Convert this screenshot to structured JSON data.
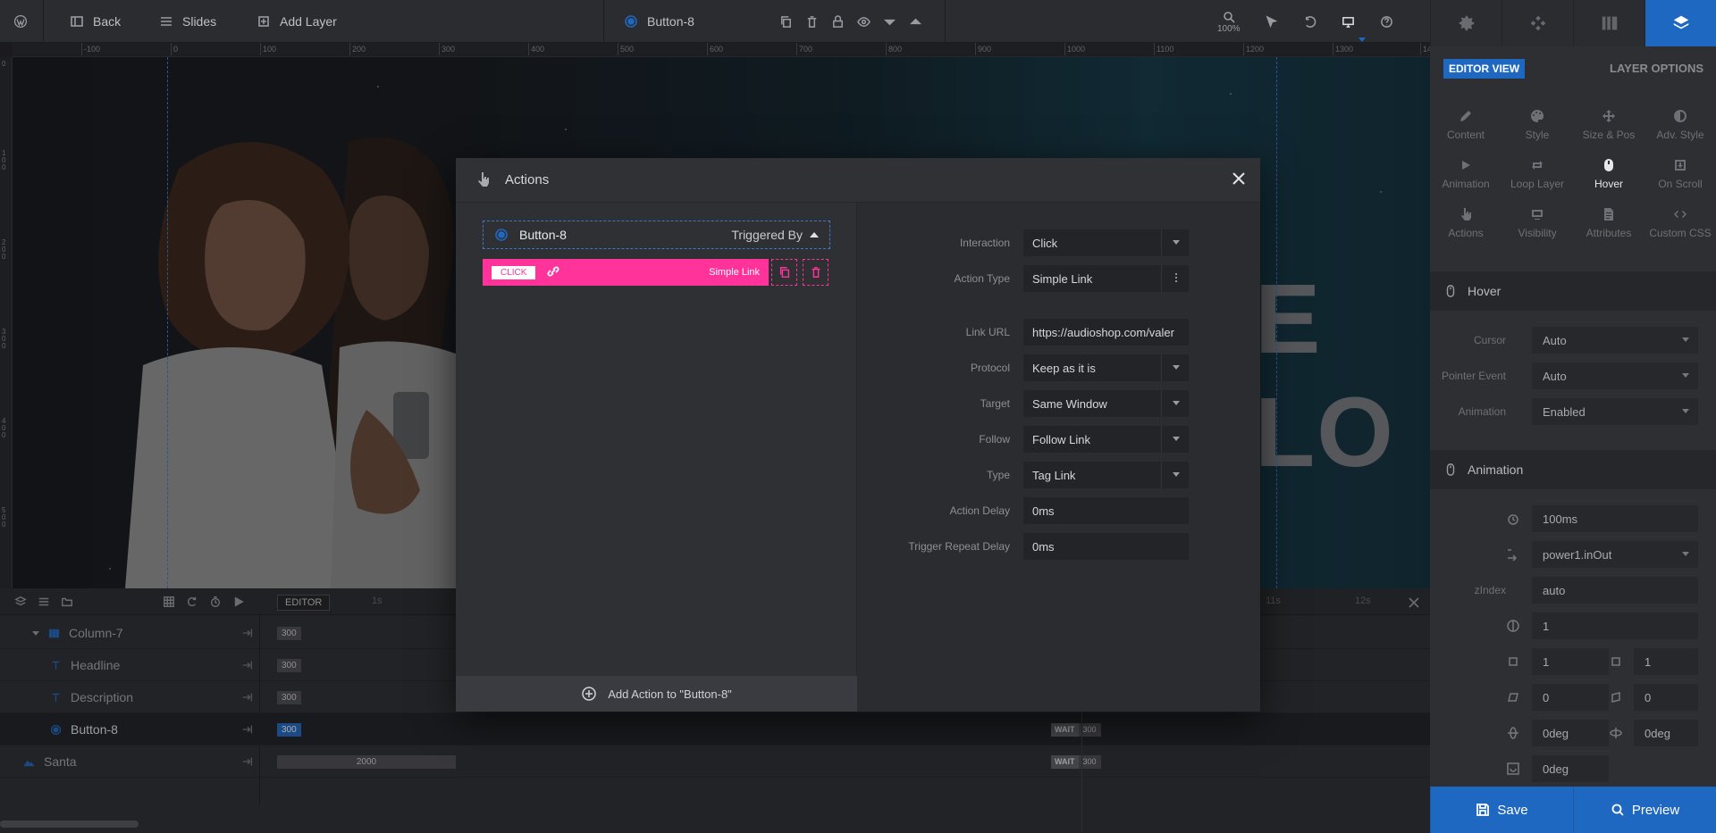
{
  "topbar": {
    "back_label": "Back",
    "slides_label": "Slides",
    "add_layer_label": "Add Layer",
    "layer_name": "Button-8",
    "zoom": "100%"
  },
  "ruler": {
    "top": [
      "-100",
      "0",
      "100",
      "200",
      "300",
      "400",
      "500",
      "600",
      "700",
      "800",
      "900",
      "1000",
      "1100",
      "1200",
      "1300",
      "14"
    ],
    "left": [
      "0",
      "100",
      "200",
      "300",
      "400",
      "500"
    ]
  },
  "canvas": {
    "big_text": "E LO"
  },
  "timeline": {
    "editor_label": "EDITOR",
    "time_1s": "1s",
    "time_11s": "11s",
    "time_12s": "12s",
    "rows": [
      {
        "name": "Column-7",
        "badge": "300"
      },
      {
        "name": "Headline",
        "badge": "300"
      },
      {
        "name": "Description",
        "badge": "300"
      },
      {
        "name": "Button-8",
        "badge": "300",
        "wait": "WAIT",
        "wait_val": "300"
      },
      {
        "name": "Santa",
        "bar": "2000",
        "wait": "WAIT",
        "wait_val": "300"
      }
    ]
  },
  "right_panel": {
    "editor_view": "EDITOR VIEW",
    "layer_options": "LAYER OPTIONS",
    "options": [
      "Content",
      "Style",
      "Size & Pos",
      "Adv. Style",
      "Animation",
      "Loop Layer",
      "Hover",
      "On Scroll",
      "Actions",
      "Visibility",
      "Attributes",
      "Custom CSS"
    ],
    "active_option": "Hover",
    "hover": {
      "title": "Hover",
      "cursor_label": "Cursor",
      "cursor": "Auto",
      "pointer_label": "Pointer Event",
      "pointer": "Auto",
      "animation_label": "Animation",
      "animation": "Enabled"
    },
    "animation": {
      "title": "Animation",
      "duration": "100ms",
      "ease": "power1.inOut",
      "zindex_label": "zIndex",
      "zindex": "auto",
      "opacity": "1",
      "scale_x": "1",
      "scale_y": "1",
      "skew_x": "0",
      "skew_y": "0",
      "rot_x": "0deg",
      "rot_y": "0deg",
      "rot_z": "0deg"
    },
    "save_label": "Save",
    "preview_label": "Preview"
  },
  "modal": {
    "title": "Actions",
    "trigger_layer": "Button-8",
    "triggered_by": "Triggered By",
    "action_event": "CLICK",
    "action_type_label": "Simple Link",
    "add_action": "Add Action to \"Button-8\"",
    "fields": {
      "interaction_label": "Interaction",
      "interaction": "Click",
      "action_type_label": "Action Type",
      "action_type": "Simple Link",
      "link_url_label": "Link URL",
      "link_url": "https://audioshop.com/valer",
      "protocol_label": "Protocol",
      "protocol": "Keep as it is",
      "target_label": "Target",
      "target": "Same Window",
      "follow_label": "Follow",
      "follow": "Follow Link",
      "type_label": "Type",
      "type": "Tag Link",
      "action_delay_label": "Action Delay",
      "action_delay": "0ms",
      "trigger_repeat_label": "Trigger Repeat Delay",
      "trigger_repeat": "0ms"
    }
  },
  "colors": {
    "accent": "#1f68c1",
    "action_pink": "#ff3399"
  }
}
